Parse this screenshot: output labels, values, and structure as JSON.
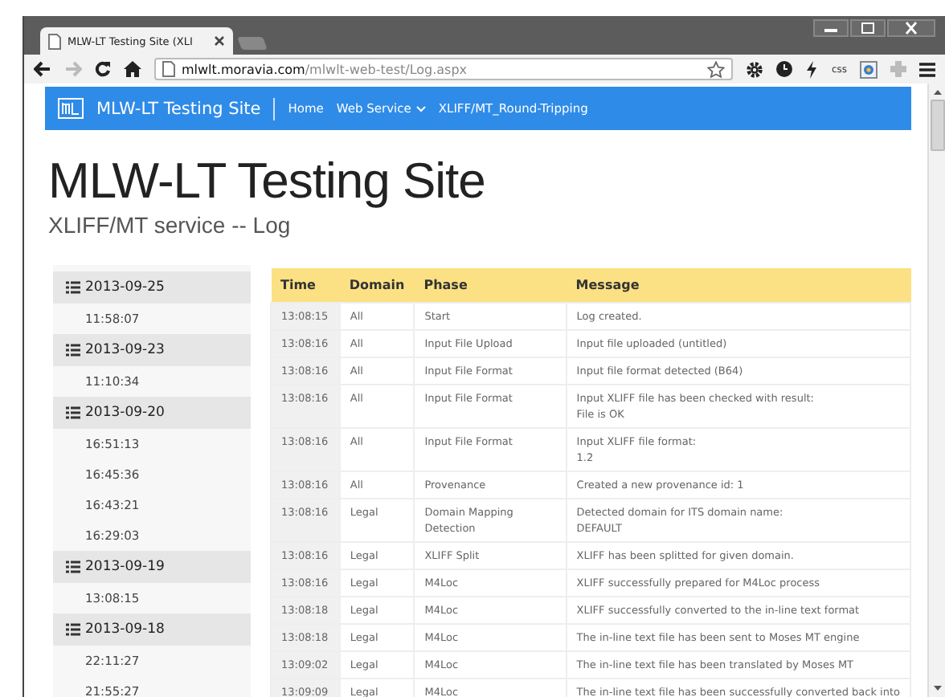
{
  "browser": {
    "tab_title": "MLW-LT Testing Site (XLI",
    "url_host": "mlwlt.moravia.com",
    "url_path": "/mlwlt-web-test/Log.aspx",
    "extension_label": "css",
    "forward_disabled": true
  },
  "nav": {
    "brand": "MLW-LT Testing Site",
    "links": [
      {
        "label": "Home",
        "dropdown": false
      },
      {
        "label": "Web Service",
        "dropdown": true
      },
      {
        "label": "XLIFF/MT_Round-Tripping",
        "dropdown": false
      }
    ]
  },
  "page": {
    "title": "MLW-LT Testing Site",
    "subtitle": "XLIFF/MT service -- Log"
  },
  "sidebar": {
    "groups": [
      {
        "date": "2013-09-25",
        "times": [
          "11:58:07"
        ]
      },
      {
        "date": "2013-09-23",
        "times": [
          "11:10:34"
        ]
      },
      {
        "date": "2013-09-20",
        "times": [
          "16:51:13",
          "16:45:36",
          "16:43:21",
          "16:29:03"
        ]
      },
      {
        "date": "2013-09-19",
        "times": [
          "13:08:15"
        ]
      },
      {
        "date": "2013-09-18",
        "times": [
          "22:11:27",
          "21:55:27"
        ]
      }
    ]
  },
  "table": {
    "columns": [
      "Time",
      "Domain",
      "Phase",
      "Message"
    ],
    "rows": [
      {
        "time": "13:08:15",
        "domain": "All",
        "phase": [
          "Start"
        ],
        "message": [
          "Log created."
        ]
      },
      {
        "time": "13:08:16",
        "domain": "All",
        "phase": [
          "Input File Upload"
        ],
        "message": [
          "Input file uploaded (untitled)"
        ]
      },
      {
        "time": "13:08:16",
        "domain": "All",
        "phase": [
          "Input File Format"
        ],
        "message": [
          "Input file format detected (B64)"
        ]
      },
      {
        "time": "13:08:16",
        "domain": "All",
        "phase": [
          "Input File Format"
        ],
        "message": [
          "Input XLIFF file has been checked with result:",
          "File is OK"
        ]
      },
      {
        "time": "13:08:16",
        "domain": "All",
        "phase": [
          "Input File Format"
        ],
        "message": [
          "Input XLIFF file format:",
          "1.2"
        ]
      },
      {
        "time": "13:08:16",
        "domain": "All",
        "phase": [
          "Provenance"
        ],
        "message": [
          "Created a new provenance id: 1"
        ]
      },
      {
        "time": "13:08:16",
        "domain": "Legal",
        "phase": [
          "Domain Mapping",
          "Detection"
        ],
        "message": [
          "Detected domain for ITS domain name:",
          "DEFAULT"
        ]
      },
      {
        "time": "13:08:16",
        "domain": "Legal",
        "phase": [
          "XLIFF Split"
        ],
        "message": [
          "XLIFF has been splitted for given domain."
        ]
      },
      {
        "time": "13:08:16",
        "domain": "Legal",
        "phase": [
          "M4Loc"
        ],
        "message": [
          "XLIFF successfully prepared for M4Loc process"
        ]
      },
      {
        "time": "13:08:18",
        "domain": "Legal",
        "phase": [
          "M4Loc"
        ],
        "message": [
          "XLIFF successfully converted to the in-line text format"
        ]
      },
      {
        "time": "13:08:18",
        "domain": "Legal",
        "phase": [
          "M4Loc"
        ],
        "message": [
          "The in-line text file has been sent to Moses MT engine"
        ]
      },
      {
        "time": "13:09:02",
        "domain": "Legal",
        "phase": [
          "M4Loc"
        ],
        "message": [
          "The in-line text file has been translated by Moses MT"
        ]
      },
      {
        "time": "13:09:09",
        "domain": "Legal",
        "phase": [
          "M4Loc"
        ],
        "message": [
          "The in-line text file has been successfully converted back into"
        ]
      }
    ]
  }
}
